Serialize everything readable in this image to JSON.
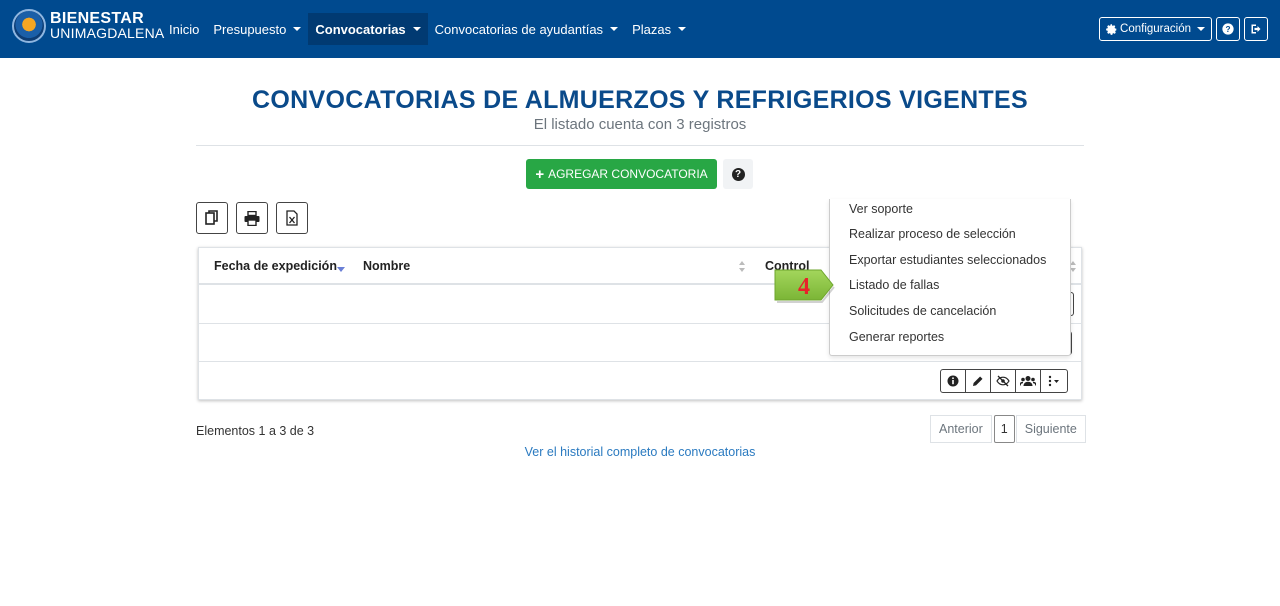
{
  "brand": {
    "line1": "BIENESTAR",
    "line2": "UNIMAGDALENA"
  },
  "nav": {
    "items": [
      {
        "label": "Inicio",
        "dropdown": false,
        "active": false
      },
      {
        "label": "Presupuesto",
        "dropdown": true,
        "active": false
      },
      {
        "label": "Convocatorias",
        "dropdown": true,
        "active": true
      },
      {
        "label": "Convocatorias de ayudantías",
        "dropdown": true,
        "active": false
      },
      {
        "label": "Plazas",
        "dropdown": true,
        "active": false
      }
    ],
    "config_label": "Configuración",
    "help_icon": "question-circle-icon",
    "logout_icon": "sign-out-icon"
  },
  "page": {
    "title": "CONVOCATORIAS DE ALMUERZOS Y REFRIGERIOS VIGENTES",
    "subtitle": "El listado cuenta con 3 registros",
    "add_button": "AGREGAR CONVOCATORIA"
  },
  "export_buttons": [
    "copy-icon",
    "print-icon",
    "excel-icon"
  ],
  "table": {
    "columns": [
      "Fecha de expedición",
      "Nombre",
      "Control"
    ]
  },
  "dropdown_menu": {
    "items": [
      "Ver soporte",
      "Realizar proceso de selección",
      "Exportar estudiantes seleccionados",
      "Listado de fallas",
      "Solicitudes de cancelación",
      "Generar reportes"
    ]
  },
  "callout": {
    "number": "4",
    "color": "#8cc63f",
    "text_color": "#e8222a"
  },
  "footer": {
    "elements_info": "Elementos 1 a 3 de 3",
    "history_link": "Ver el historial completo de convocatorias"
  },
  "pagination": {
    "prev": "Anterior",
    "current": "1",
    "next": "Siguiente"
  },
  "colors": {
    "navbar": "#004a8f",
    "add_button": "#28a745",
    "title": "#0a4a8a",
    "link": "#2a7ac0"
  }
}
